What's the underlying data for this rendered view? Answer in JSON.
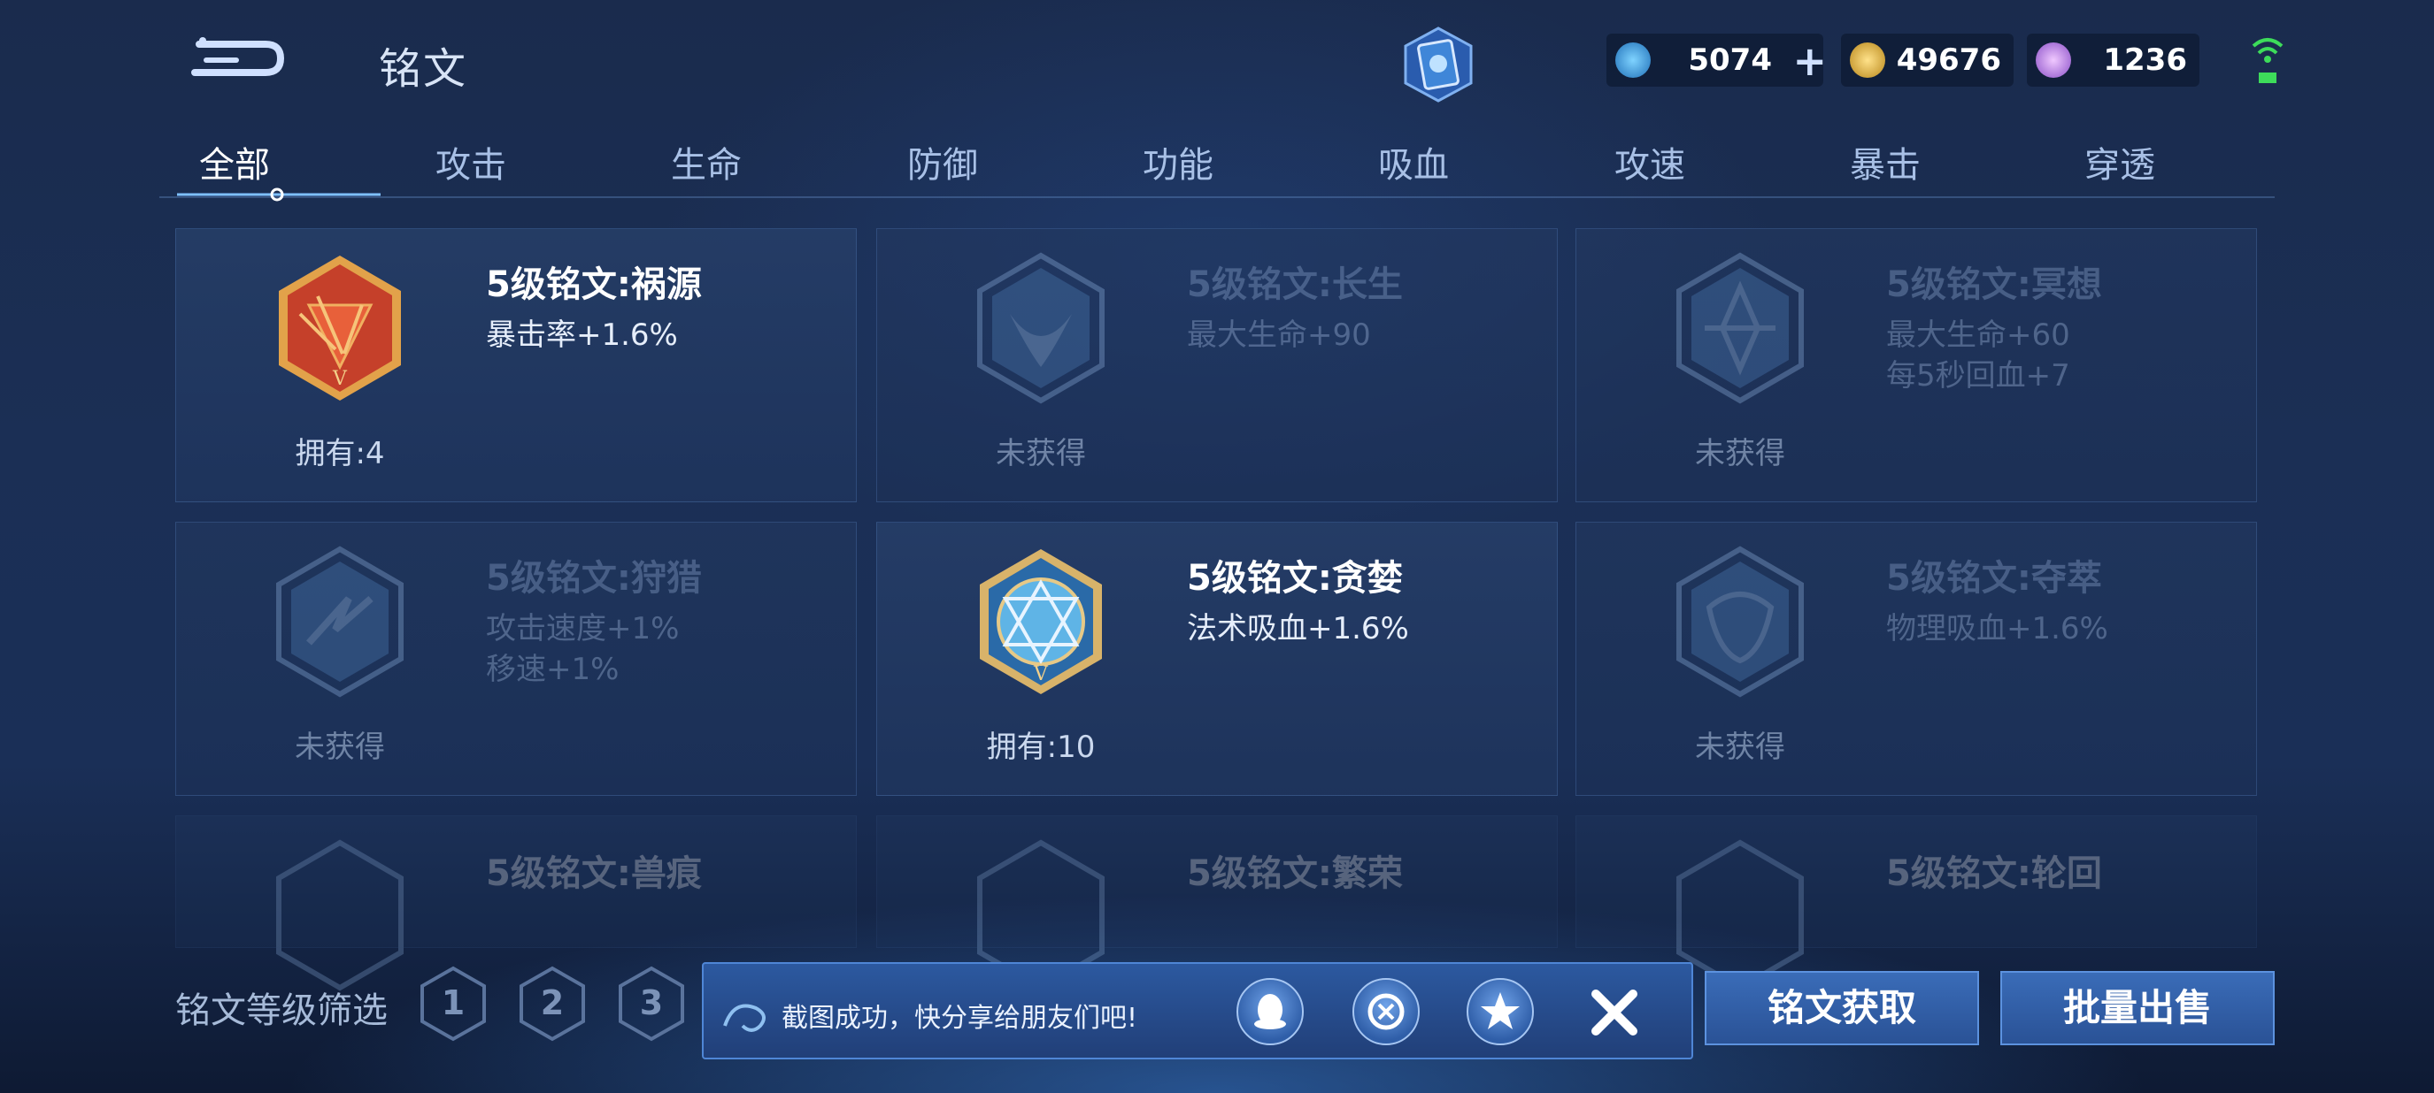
{
  "header": {
    "title": "铭文",
    "currencies": [
      {
        "name": "diamond",
        "icon": "diamond-icon",
        "value": "5074",
        "has_plus": true
      },
      {
        "name": "gold-coin",
        "icon": "gold-coin-icon",
        "value": "49676"
      },
      {
        "name": "crystal",
        "icon": "crystal-gem-icon",
        "value": "1236"
      }
    ]
  },
  "tabs": [
    {
      "label": "全部",
      "active": true
    },
    {
      "label": "攻击"
    },
    {
      "label": "生命"
    },
    {
      "label": "防御"
    },
    {
      "label": "功能"
    },
    {
      "label": "吸血"
    },
    {
      "label": "攻速"
    },
    {
      "label": "暴击"
    },
    {
      "label": "穿透"
    }
  ],
  "inscriptions": [
    {
      "name": "5级铭文:祸源",
      "attrs": [
        "暴击率+1.6%"
      ],
      "owned": "拥有:4",
      "locked": false,
      "color": "#c9452a"
    },
    {
      "name": "5级铭文:长生",
      "attrs": [
        "最大生命+90"
      ],
      "owned": "未获得",
      "locked": true
    },
    {
      "name": "5级铭文:冥想",
      "attrs": [
        "最大生命+60",
        "每5秒回血+7"
      ],
      "owned": "未获得",
      "locked": true
    },
    {
      "name": "5级铭文:狩猎",
      "attrs": [
        "攻击速度+1%",
        "移速+1%"
      ],
      "owned": "未获得",
      "locked": true
    },
    {
      "name": "5级铭文:贪婪",
      "attrs": [
        "法术吸血+1.6%"
      ],
      "owned": "拥有:10",
      "locked": false,
      "color": "#3d8fc9"
    },
    {
      "name": "5级铭文:夺萃",
      "attrs": [
        "物理吸血+1.6%"
      ],
      "owned": "未获得",
      "locked": true
    },
    {
      "name": "5级铭文:兽痕",
      "faded": true
    },
    {
      "name": "5级铭文:繁荣",
      "faded": true
    },
    {
      "name": "5级铭文:轮回",
      "faded": true
    }
  ],
  "bottom": {
    "filter_label": "铭文等级筛选",
    "levels": [
      "1",
      "2",
      "3"
    ],
    "toast_text": "截图成功，快分享给朋友们吧!",
    "share_icons": [
      "qq-icon",
      "wechat-moments-icon",
      "qzone-icon"
    ],
    "acquire_label": "铭文获取",
    "sell_label": "批量出售"
  }
}
